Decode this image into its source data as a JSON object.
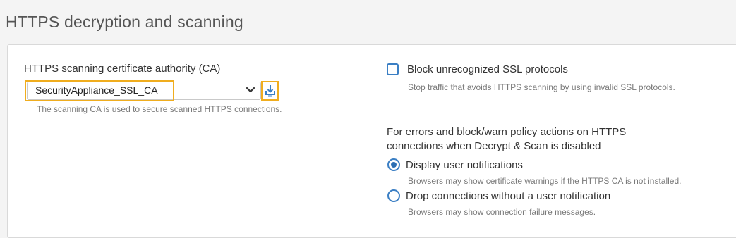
{
  "section": {
    "title": "HTTPS decryption and scanning"
  },
  "ca_field": {
    "label": "HTTPS scanning certificate authority (CA)",
    "selected_value": "SecurityAppliance_SSL_CA",
    "hint": "The scanning CA is used to secure scanned HTTPS connections.",
    "download_icon": "download-icon",
    "highlight_color": "#f0ad1e"
  },
  "block_ssl": {
    "label": "Block unrecognized SSL protocols",
    "checked": false,
    "hint": "Stop traffic that avoids HTTPS scanning by using invalid SSL protocols."
  },
  "errors_group": {
    "label_line1": "For errors and block/warn policy actions on HTTPS",
    "label_line2": "connections when Decrypt & Scan is disabled",
    "options": [
      {
        "label": "Display user notifications",
        "hint": "Browsers may show certificate warnings if the HTTPS CA is not installed.",
        "selected": true
      },
      {
        "label": "Drop connections without a user notification",
        "hint": "Browsers may show connection failure messages.",
        "selected": false
      }
    ]
  },
  "colors": {
    "accent": "#3b7fc4",
    "highlight": "#f0ad1e"
  }
}
